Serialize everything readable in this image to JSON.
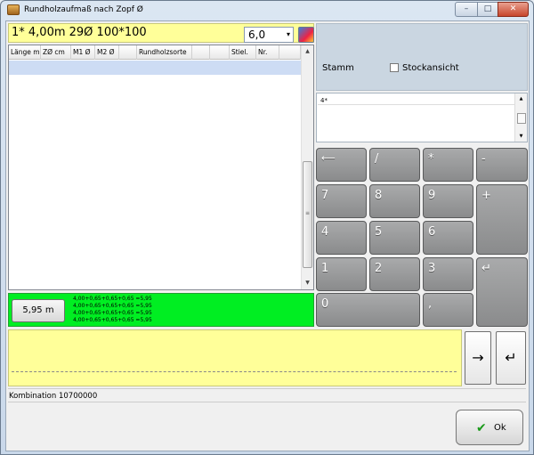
{
  "window": {
    "title": "Rundholzaufmaß nach Zopf Ø",
    "min": "–",
    "max": "□",
    "close": "✕"
  },
  "formula": {
    "text": "1* 4,00m 29Ø 100*100",
    "combo_value": "6,0",
    "combo_arrow": "▾"
  },
  "grid": {
    "columns": [
      "Länge m",
      "ZØ cm",
      "M1 Ø",
      "M2 Ø",
      "",
      "Rundholzsorte",
      "",
      "",
      "Stiel.",
      "Nr.",
      ""
    ],
    "scroll_up": "▲",
    "scroll_down": "▼",
    "scroll_grip": "≡"
  },
  "result": {
    "button": "5,95 m",
    "lines": [
      "4,00+0,65+0,65+0,65 =5,95",
      "4,00+0,65+0,65+0,65 =5,95",
      "4,00+0,65+0,65+0,65 =5,95",
      "4,00+0,65+0,65+0,65 =5,95"
    ]
  },
  "panel": {
    "stamm": "Stamm",
    "stockansicht": "Stockansicht"
  },
  "memo": {
    "text": "4*"
  },
  "keypad": {
    "back": "⟵",
    "slash": "/",
    "star": "*",
    "minus": "-",
    "k7": "7",
    "k8": "8",
    "k9": "9",
    "plus": "+",
    "k4": "4",
    "k5": "5",
    "k6": "6",
    "k1": "1",
    "k2": "2",
    "k3": "3",
    "enter": "↵",
    "k0": "0",
    "comma": ","
  },
  "nav": {
    "next": "→",
    "enter": "↵"
  },
  "status": {
    "text": "Kombination 10700000"
  },
  "ok": {
    "check": "✔",
    "label": "Ok"
  },
  "colors": {
    "yellow": "#ffff99",
    "green": "#00ee22",
    "panel": "#cad6e1",
    "key": "#9a9b9c"
  }
}
